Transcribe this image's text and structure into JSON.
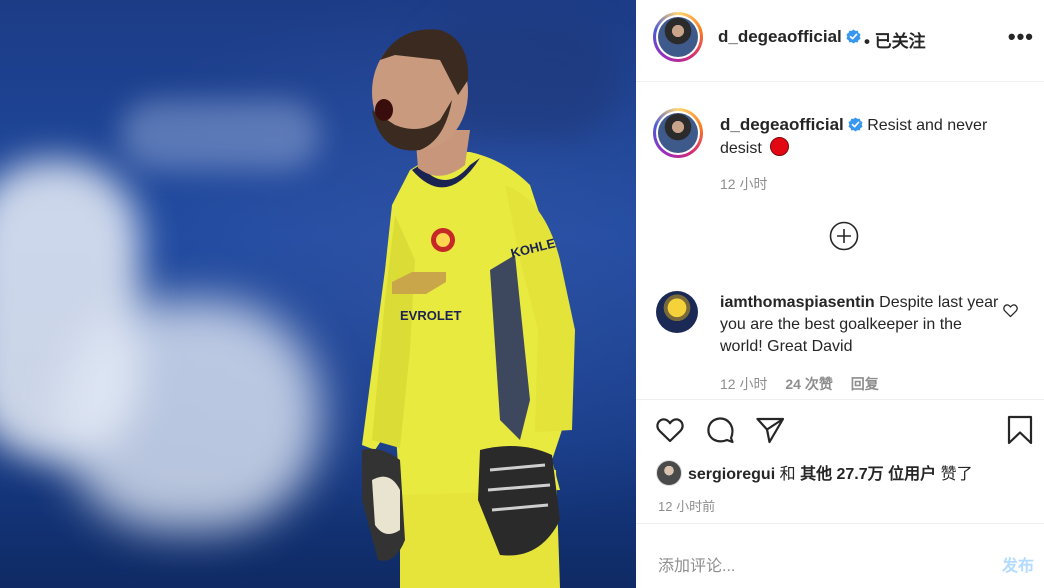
{
  "post": {
    "username": "d_degeaofficial",
    "follow_status": "• 已关注",
    "more_label": "•••",
    "caption_text": "Resist and never desist",
    "caption_time": "12 小时",
    "photo_alt": "goalkeeper in yellow kit shouting"
  },
  "comment": {
    "username": "iamthomaspiasentin",
    "text": "Despite last year you are the best goalkeeper in the world! Great David",
    "time": "12 小时",
    "likes": "24 次赞",
    "reply": "回复"
  },
  "likes": {
    "user": "sergioregui",
    "and": "和",
    "others": "其他 27.7万 位用户",
    "suffix": "赞了"
  },
  "post_time": "12 小时前",
  "add_comment": {
    "placeholder": "添加评论...",
    "post_label": "发布"
  },
  "icons": [
    "verified-badge-icon",
    "more-options-icon",
    "load-more-icon",
    "heart-icon",
    "comment-icon",
    "share-icon",
    "bookmark-icon"
  ],
  "colors": {
    "verified": "#3897f0",
    "post_disabled": "#b3dbff",
    "secondary_text": "#8e8e8e"
  }
}
